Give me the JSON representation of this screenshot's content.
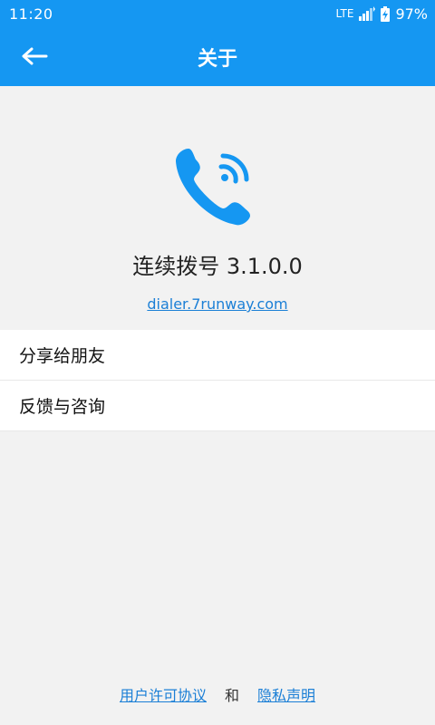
{
  "status_bar": {
    "time": "11:20",
    "network": "LTE",
    "battery": "97%"
  },
  "header": {
    "title": "关于",
    "back_icon": "arrow-left-icon"
  },
  "app_info": {
    "logo_icon": "phone-calling-icon",
    "name_version": "连续拨号 3.1.0.0",
    "website": "dialer.7runway.com"
  },
  "menu": {
    "items": [
      {
        "label": "分享给朋友"
      },
      {
        "label": "反馈与咨询"
      }
    ]
  },
  "footer": {
    "license_link": "用户许可协议",
    "and": "和",
    "privacy_link": "隐私声明"
  },
  "colors": {
    "primary": "#1597f2",
    "link": "#1b7fd6",
    "background": "#f2f2f2"
  }
}
